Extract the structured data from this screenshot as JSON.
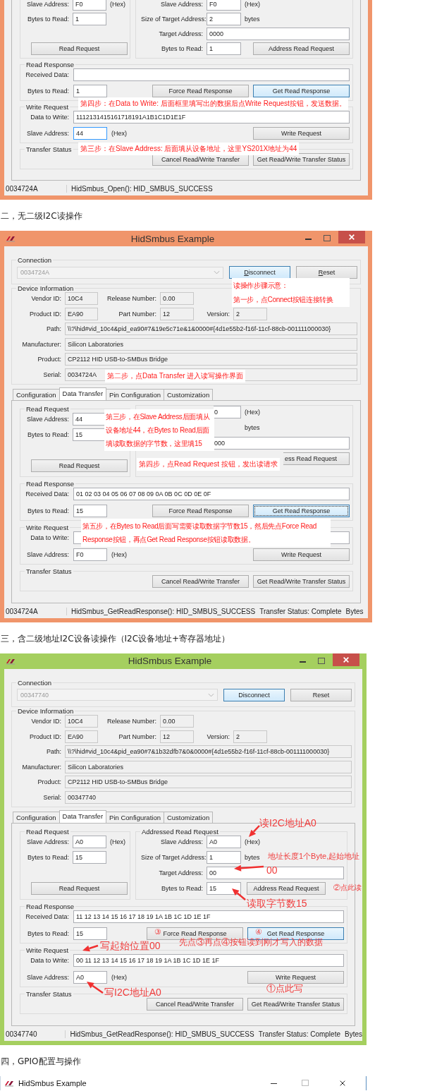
{
  "blocks": [
    {
      "kind": "window",
      "color": "#f0956b",
      "data_transfer": {
        "read_request": {
          "slave": {
            "label": "Slave Address:",
            "value": "F0",
            "suffix": "(Hex)"
          },
          "bytes": {
            "label": "Bytes to Read:",
            "value": "1"
          },
          "button": {
            "label": "Read Request"
          }
        },
        "addressed_read_request": {
          "slave": {
            "label": "Slave Address:",
            "value": "F0",
            "suffix": "(Hex)"
          },
          "size": {
            "label": "Size of Target Address:",
            "value": "2",
            "suffix": "bytes"
          },
          "target": {
            "label": "Target Address:",
            "value": "0000"
          },
          "bytes": {
            "label": "Bytes to Read:",
            "value": "1"
          },
          "button": {
            "label": "Address Read Request"
          }
        },
        "read_response": {
          "title": "Read Response",
          "received": {
            "label": "Received Data:"
          },
          "bytes": {
            "label": "Bytes to Read:",
            "value": "1"
          },
          "force": {
            "label": "Force Read Response",
            "highlighted": false
          },
          "get": {
            "label": "Get Read Response",
            "highlighted": true
          }
        },
        "write_request": {
          "title": "Write Request",
          "data": {
            "label": "Data to Write:",
            "value": "1112131415161718191A1B1C1D1E1F"
          },
          "slave": {
            "label": "Slave Address:",
            "value": "44",
            "suffix": "(Hex)",
            "focused": true
          },
          "button": {
            "label": "Write Request"
          }
        },
        "transfer_status": {
          "title": "Transfer Status",
          "cancel": {
            "label": "Cancel Read/Write Transfer"
          },
          "status": {
            "label": "Get Read/Write Transfer Status"
          }
        }
      },
      "status_bar": [
        "0034724A",
        "HidSmbus_Open(): HID_SMBUS_SUCCESS"
      ],
      "annotations": [
        {
          "kind": "note",
          "text": "第四步：在Data to Write: 后面框里填写出的数据后点Write Request按钮，发送数据。"
        },
        {
          "kind": "note",
          "text": "第三步：在Slave Address: 后面填从设备地址，这里YS201X地址为44"
        }
      ]
    },
    {
      "kind": "heading",
      "text": "二，无二级I2C读操作"
    },
    {
      "kind": "window",
      "color": "#f0956b",
      "title": "HidSmbus Example",
      "connection": {
        "title": "Connection",
        "device": "0034724A",
        "disconnect": {
          "label": "Disconnect",
          "highlighted": true,
          "mnemonic": true
        },
        "reset": {
          "label": "Reset",
          "highlighted": false,
          "mnemonic": true
        }
      },
      "device_info": {
        "title": "Device Information",
        "vendor_id": {
          "label": "Vendor ID:",
          "value": "10C4"
        },
        "release_number": {
          "label": "Release Number:",
          "value": "0.00"
        },
        "product_id": {
          "label": "Product ID:",
          "value": "EA90"
        },
        "part_number": {
          "label": "Part Number:",
          "value": "12"
        },
        "version": {
          "label": "Version:",
          "value": "2"
        },
        "path": {
          "label": "Path:",
          "value": "\\\\?\\hid#vid_10c4&pid_ea90#7&19e5c71e&1&0000#{4d1e55b2-f16f-11cf-88cb-001111000030}"
        },
        "manufacturer": {
          "label": "Manufacturer:",
          "value": "Silicon Laboratories"
        },
        "product": {
          "label": "Product:",
          "value": "CP2112 HID USB-to-SMBus Bridge"
        },
        "serial": {
          "label": "Serial:",
          "value": "0034724A"
        }
      },
      "tabs": [
        {
          "label": "Configuration",
          "selected": false
        },
        {
          "label": "Data Transfer",
          "selected": true
        },
        {
          "label": "Pin Configuration",
          "selected": false
        },
        {
          "label": "Customization",
          "selected": false
        }
      ],
      "data_transfer": {
        "read_request": {
          "title": "Read Request",
          "slave": {
            "label": "Slave Address:",
            "value": "44"
          },
          "bytes": {
            "label": "Bytes to Read:",
            "value": "15"
          },
          "button": {
            "label": "Read Request"
          }
        },
        "addressed_read_request": {
          "slave": {
            "value": "0",
            "suffix": "(Hex)",
            "covered": true
          },
          "size": {
            "suffix": "bytes"
          },
          "target": {
            "value": "000",
            "covered": true
          },
          "button": {
            "label": "ess Read Request",
            "covered": true
          }
        },
        "read_response": {
          "title": "Read Response",
          "received": {
            "label": "Received Data:",
            "value": "01 02 03 04 05 06 07 08 09 0A 0B 0C 0D 0E 0F"
          },
          "bytes": {
            "label": "Bytes to Read:",
            "value": "15"
          },
          "force": {
            "label": "Force Read Response",
            "highlighted": false
          },
          "get": {
            "label": "Get Read Response",
            "highlighted": true,
            "focused": true
          }
        },
        "write_request": {
          "title": "Write Request",
          "data": {
            "label": "Data to Write:"
          },
          "slave": {
            "label": "Slave Address:",
            "value": "F0",
            "suffix": "(Hex)"
          },
          "button": {
            "label": "Write Request"
          }
        },
        "transfer_status": {
          "title": "Transfer Status",
          "cancel": {
            "label": "Cancel Read/Write Transfer"
          },
          "status": {
            "label": "Get Read/Write Transfer Status"
          }
        }
      },
      "status_bar": [
        "0034724A",
        "HidSmbus_GetReadResponse(): HID_SMBUS_SUCCESS",
        "Transfer Status: Complete",
        "Bytes"
      ],
      "annotations": [
        {
          "kind": "note",
          "text": "读操作步骤示意："
        },
        {
          "kind": "note",
          "text": "第一步，点Connect按钮连接转换"
        },
        {
          "kind": "note",
          "text": "第二步，点Data Transfer 进入读写操作界面"
        },
        {
          "kind": "note",
          "text": "第三步，在Slave Address后面填从设备地址44，在Bytes to Read后面填读取数据的字节数，这里填15"
        },
        {
          "kind": "note",
          "text": "第四步，点Read Request 按钮，发出读请求"
        },
        {
          "kind": "note",
          "text": "第五步，在Bytes to Read后面写需要读取数据字节数15，然后先点Force Read Response按钮，再点Get Read Response按钮读取数据。"
        }
      ]
    },
    {
      "kind": "heading",
      "text": "三，含二级地址I2C设备读操作（I2C设备地址+寄存器地址）"
    },
    {
      "kind": "window",
      "color": "#a5cf5f",
      "title": "HidSmbus Example",
      "connection": {
        "title": "Connection",
        "device": "00347740",
        "disconnect": {
          "label": "Disconnect",
          "highlighted": true,
          "mnemonic": false
        },
        "reset": {
          "label": "Reset",
          "highlighted": false,
          "mnemonic": false
        }
      },
      "device_info": {
        "title": "Device Information",
        "vendor_id": {
          "label": "Vendor ID:",
          "value": "10C4"
        },
        "release_number": {
          "label": "Release Number:",
          "value": "0.00"
        },
        "product_id": {
          "label": "Product ID:",
          "value": "EA90"
        },
        "part_number": {
          "label": "Part Number:",
          "value": "12"
        },
        "version": {
          "label": "Version:",
          "value": "2"
        },
        "path": {
          "label": "Path:",
          "value": "\\\\?\\hid#vid_10c4&pid_ea90#7&1b32dfb7&0&0000#{4d1e55b2-f16f-11cf-88cb-001111000030}"
        },
        "manufacturer": {
          "label": "Manufacturer:",
          "value": "Silicon Laboratories"
        },
        "product": {
          "label": "Product:",
          "value": "CP2112 HID USB-to-SMBus Bridge"
        },
        "serial": {
          "label": "Serial:",
          "value": "00347740"
        }
      },
      "tabs": [
        {
          "label": "Configuration",
          "selected": false
        },
        {
          "label": "Data Transfer",
          "selected": true
        },
        {
          "label": "Pin Configuration",
          "selected": false
        },
        {
          "label": "Customization",
          "selected": false
        }
      ],
      "data_transfer": {
        "read_request": {
          "title": "Read Request",
          "slave": {
            "label": "Slave Address:",
            "value": "A0",
            "suffix": "(Hex)"
          },
          "bytes": {
            "label": "Bytes to Read:",
            "value": "15"
          },
          "button": {
            "label": "Read Request"
          }
        },
        "addressed_read_request": {
          "title": "Addressed Read Request",
          "slave": {
            "label": "Slave Address:",
            "value": "A0",
            "suffix": "(Hex)"
          },
          "size": {
            "label": "Size of Target Address:",
            "value": "1",
            "suffix": "bytes"
          },
          "target": {
            "label": "Target Address:",
            "value": "00"
          },
          "bytes": {
            "label": "Bytes to Read:",
            "value": "15"
          },
          "button": {
            "label": "Address Read Request"
          }
        },
        "read_response": {
          "title": "Read Response",
          "received": {
            "label": "Received Data:",
            "value": "11 12 13 14 15 16 17 18 19 1A 1B 1C 1D 1E 1F"
          },
          "bytes": {
            "label": "Bytes to Read:",
            "value": "15"
          },
          "force": {
            "label": "Force Read Response",
            "highlighted": false
          },
          "get": {
            "label": "Get Read Response",
            "highlighted": true
          }
        },
        "write_request": {
          "title": "Write Request",
          "data": {
            "label": "Data to Write:",
            "value": "00 11 12 13 14 15 16 17 18 19 1A 1B 1C 1D 1E 1F"
          },
          "slave": {
            "label": "Slave Address:",
            "value": "A0",
            "suffix": "(Hex)"
          },
          "button": {
            "label": "Write Request"
          }
        },
        "transfer_status": {
          "title": "Transfer Status",
          "cancel": {
            "label": "Cancel Read/Write Transfer"
          },
          "status": {
            "label": "Get Read/Write Transfer Status"
          }
        }
      },
      "status_bar": [
        "00347740",
        "HidSmbus_GetReadResponse(): HID_SMBUS_SUCCESS",
        "Transfer Status: Complete",
        "Bytes"
      ],
      "annotations": [
        {
          "kind": "callout",
          "text": "读I2C地址A0",
          "arrow": true
        },
        {
          "kind": "callout",
          "text": "地址长度1个Byte,起始地址",
          "arrow": true
        },
        {
          "kind": "callout",
          "text": "00"
        },
        {
          "kind": "callout",
          "text": "②点此读"
        },
        {
          "kind": "callout",
          "text": "读取字节数15",
          "arrow": true
        },
        {
          "kind": "callout",
          "text": "③"
        },
        {
          "kind": "callout",
          "text": "④"
        },
        {
          "kind": "callout",
          "text": "写起始位置00",
          "arrow": true
        },
        {
          "kind": "callout",
          "text": "先点③再点④按钮读到刚才写入的数据"
        },
        {
          "kind": "callout",
          "text": "①点此写"
        },
        {
          "kind": "callout",
          "text": "写I2C地址A0",
          "arrow": true
        }
      ]
    },
    {
      "kind": "heading",
      "text": "四，GPIO配置与操作"
    },
    {
      "kind": "window",
      "color": "#5b8fc0",
      "title": "HidSmbus Example"
    }
  ]
}
